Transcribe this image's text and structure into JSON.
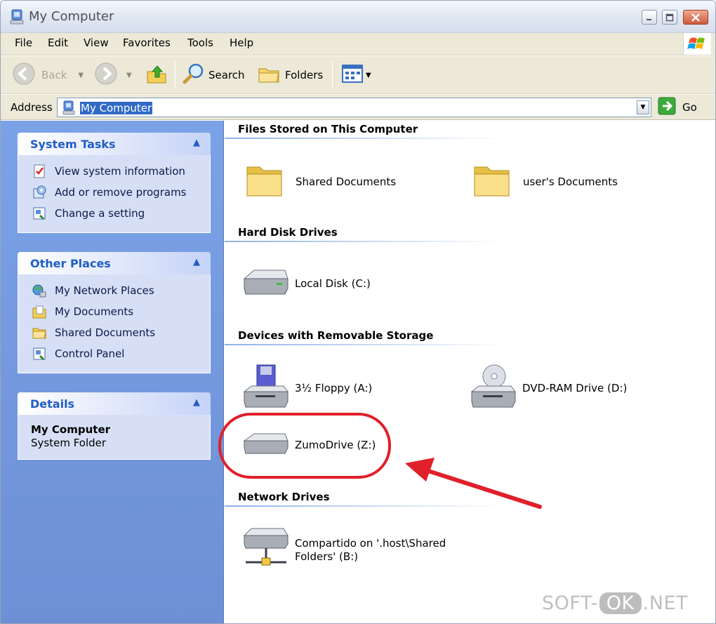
{
  "window": {
    "title": "My Computer"
  },
  "menubar": {
    "items": [
      "File",
      "Edit",
      "View",
      "Favorites",
      "Tools",
      "Help"
    ]
  },
  "toolbar": {
    "back_label": "Back",
    "search_label": "Search",
    "folders_label": "Folders"
  },
  "address": {
    "label": "Address",
    "value": "My Computer",
    "go_label": "Go"
  },
  "sidebar": {
    "system_tasks": {
      "title": "System Tasks",
      "items": [
        "View system information",
        "Add or remove programs",
        "Change a setting"
      ]
    },
    "other_places": {
      "title": "Other Places",
      "items": [
        "My Network Places",
        "My Documents",
        "Shared Documents",
        "Control Panel"
      ]
    },
    "details": {
      "title": "Details",
      "name": "My Computer",
      "type": "System Folder"
    }
  },
  "content": {
    "groups": [
      {
        "title": "Files Stored on This Computer",
        "items": [
          "Shared Documents",
          "user's Documents"
        ]
      },
      {
        "title": "Hard Disk Drives",
        "items": [
          "Local Disk (C:)"
        ]
      },
      {
        "title": "Devices with Removable Storage",
        "items": [
          "3½ Floppy (A:)",
          "DVD-RAM Drive (D:)",
          "ZumoDrive (Z:)"
        ]
      },
      {
        "title": "Network Drives",
        "items": [
          "Compartido on '.host\\Shared Folders' (B:)"
        ]
      }
    ]
  },
  "watermark": {
    "pre": "SOFT-",
    "ok": "OK",
    "post": ".NET"
  },
  "colors": {
    "taskpane_bg": "#7ba2e7",
    "panel_title": "#215dc6",
    "annotation_red": "#e0202a"
  }
}
